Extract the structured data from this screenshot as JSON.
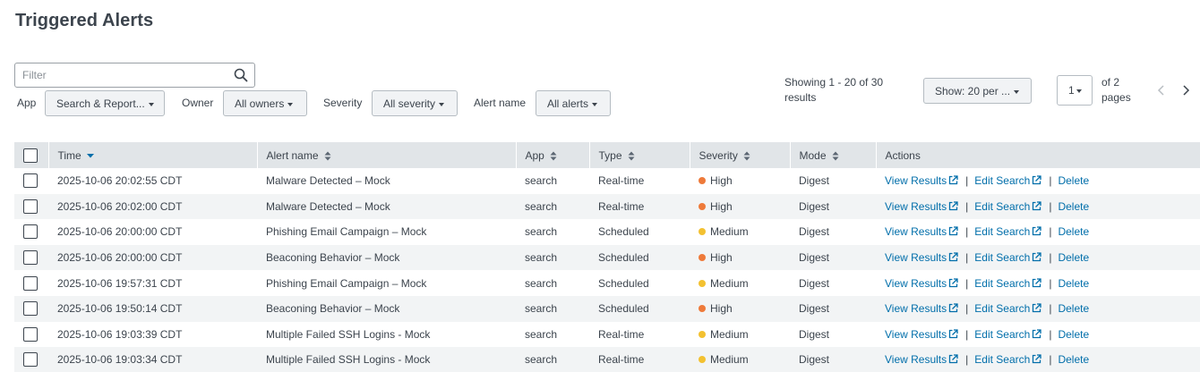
{
  "page": {
    "title": "Triggered Alerts"
  },
  "filter": {
    "placeholder": "Filter",
    "value": ""
  },
  "facets": {
    "app": {
      "label": "App",
      "value": "Search & Report..."
    },
    "owner": {
      "label": "Owner",
      "value": "All owners"
    },
    "severity": {
      "label": "Severity",
      "value": "All severity"
    },
    "alert_name": {
      "label": "Alert name",
      "value": "All alerts"
    }
  },
  "pagination": {
    "showing": "Showing 1 - 20 of 30 results",
    "per_page": "Show: 20 per ...",
    "page": "1",
    "of_pages": "of 2 pages"
  },
  "table": {
    "columns": [
      "Time",
      "Alert name",
      "App",
      "Type",
      "Severity",
      "Mode",
      "Actions"
    ],
    "actions": {
      "view": "View Results",
      "edit": "Edit Search",
      "delete": "Delete",
      "sep": "|"
    },
    "rows": [
      {
        "time": "2025-10-06 20:02:55 CDT",
        "alert_name": "Malware Detected – Mock",
        "app": "search",
        "type": "Real-time",
        "severity": "High",
        "mode": "Digest"
      },
      {
        "time": "2025-10-06 20:02:00 CDT",
        "alert_name": "Malware Detected – Mock",
        "app": "search",
        "type": "Real-time",
        "severity": "High",
        "mode": "Digest"
      },
      {
        "time": "2025-10-06 20:00:00 CDT",
        "alert_name": "Phishing Email Campaign – Mock",
        "app": "search",
        "type": "Scheduled",
        "severity": "Medium",
        "mode": "Digest"
      },
      {
        "time": "2025-10-06 20:00:00 CDT",
        "alert_name": "Beaconing Behavior – Mock",
        "app": "search",
        "type": "Scheduled",
        "severity": "High",
        "mode": "Digest"
      },
      {
        "time": "2025-10-06 19:57:31 CDT",
        "alert_name": "Phishing Email Campaign – Mock",
        "app": "search",
        "type": "Scheduled",
        "severity": "Medium",
        "mode": "Digest"
      },
      {
        "time": "2025-10-06 19:50:14 CDT",
        "alert_name": "Beaconing Behavior – Mock",
        "app": "search",
        "type": "Scheduled",
        "severity": "High",
        "mode": "Digest"
      },
      {
        "time": "2025-10-06 19:03:39 CDT",
        "alert_name": "Multiple Failed SSH Logins - Mock",
        "app": "search",
        "type": "Real-time",
        "severity": "Medium",
        "mode": "Digest"
      },
      {
        "time": "2025-10-06 19:03:34 CDT",
        "alert_name": "Multiple Failed SSH Logins - Mock",
        "app": "search",
        "type": "Real-time",
        "severity": "Medium",
        "mode": "Digest"
      }
    ]
  },
  "colors": {
    "high": "#ee7a3a",
    "medium": "#f3c131",
    "link": "#006eaa",
    "header_bg": "#e1e5e8"
  }
}
